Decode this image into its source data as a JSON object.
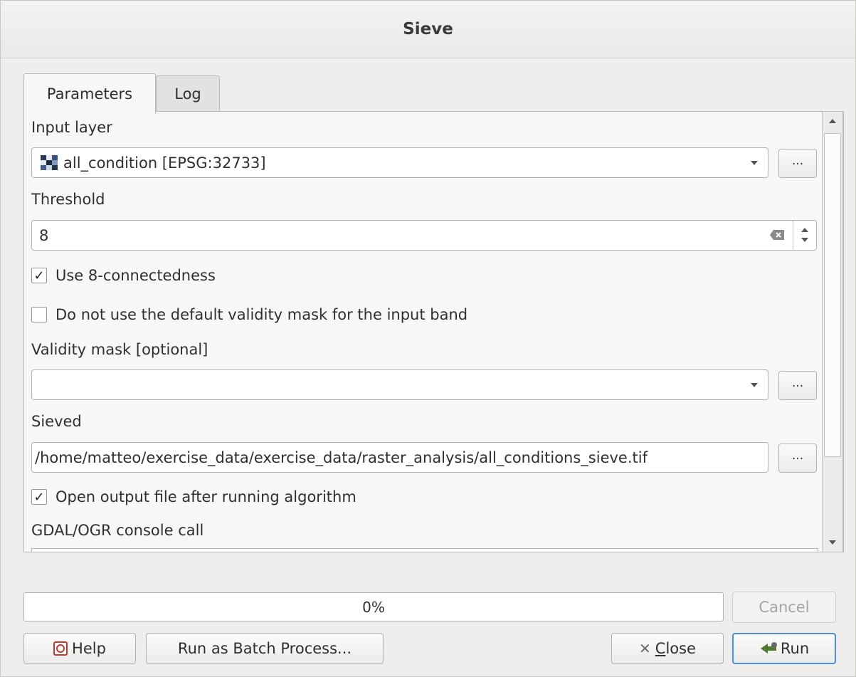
{
  "window": {
    "title": "Sieve"
  },
  "tabs": [
    {
      "label": "Parameters",
      "active": true
    },
    {
      "label": "Log",
      "active": false
    }
  ],
  "params": {
    "input_layer": {
      "label": "Input layer",
      "value": "all_condition [EPSG:32733]",
      "browse": "..."
    },
    "threshold": {
      "label": "Threshold",
      "value": "8"
    },
    "eight_connectedness": {
      "label": "Use 8-connectedness",
      "checked": true,
      "mark": "✓"
    },
    "no_default_mask": {
      "label": "Do not use the default validity mask for the input band",
      "checked": false,
      "mark": ""
    },
    "validity_mask": {
      "label": "Validity mask [optional]",
      "value": "",
      "browse": "..."
    },
    "sieved": {
      "label": "Sieved",
      "value": "/home/matteo/exercise_data/exercise_data/raster_analysis/all_conditions_sieve.tif",
      "browse": "..."
    },
    "open_output": {
      "label": "Open output file after running algorithm",
      "checked": true,
      "mark": "✓"
    },
    "gdal_console": {
      "label": "GDAL/OGR console call"
    }
  },
  "progress": {
    "text": "0%",
    "value": 0
  },
  "buttons": {
    "cancel": "Cancel",
    "help": "Help",
    "batch": "Run as Batch Process...",
    "close_prefix": "",
    "close_underlined": "C",
    "close_rest": "lose",
    "run": "Run"
  },
  "icons": {
    "input_layer": "raster-layer-icon",
    "clear": "backspace-clear-icon",
    "help": "help-lifebuoy-icon",
    "close": "close-x-icon",
    "run": "run-gear-arrow-icon"
  },
  "colors": {
    "accent": "#4a90d9",
    "help_icon": "#c0392b",
    "run_icon": "#4d7a2e"
  }
}
